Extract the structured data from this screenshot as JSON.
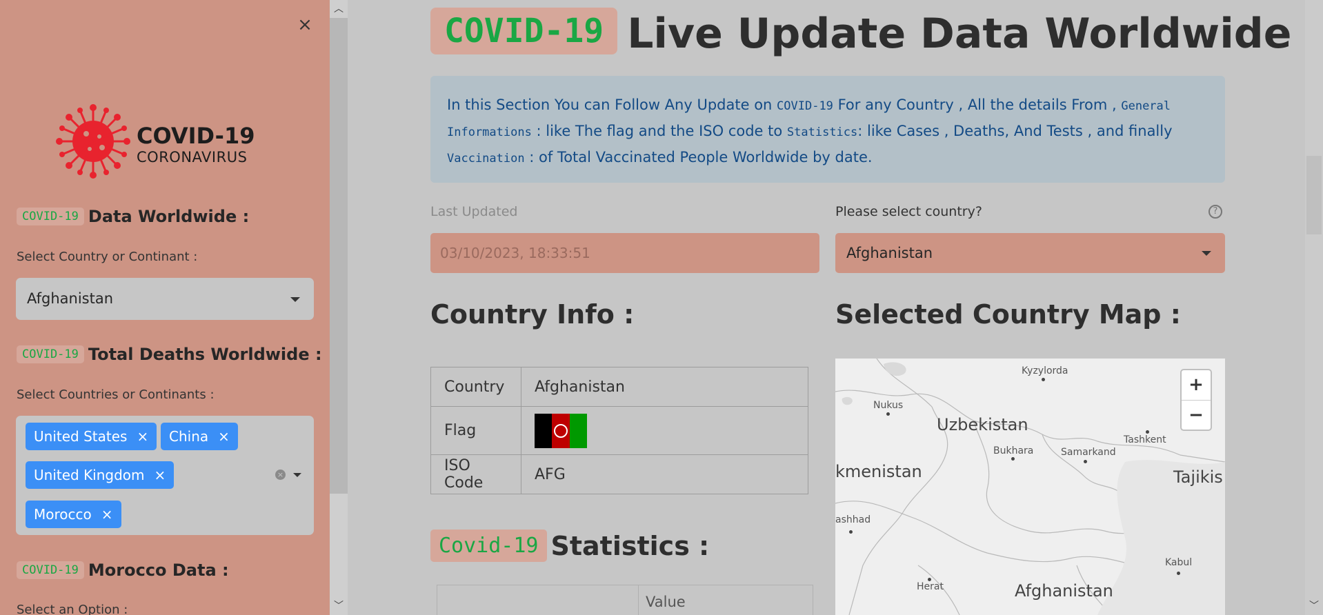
{
  "sidebar": {
    "close_label": "×",
    "logo": {
      "title": "COVID-19",
      "subtitle": "CORONAVIRUS"
    },
    "sections": [
      {
        "tag": "COVID-19",
        "title": "Data Worldwide :",
        "label": "Select Country or Continant :",
        "value": "Afghanistan"
      },
      {
        "tag": "COVID-19",
        "title": "Total Deaths Worldwide :",
        "label": "Select Countries or Continants :"
      },
      {
        "tag": "COVID-19",
        "title": "Morocco Data :",
        "label": "Select an Option :"
      }
    ],
    "chips": [
      "United States",
      "China",
      "United Kingdom",
      "Morocco"
    ],
    "chip_remove": "×"
  },
  "main": {
    "title_tag": "COVID-19",
    "title": "Live Update Data Worldwide :",
    "info": {
      "t1": "In this Section You can Follow Any Update on ",
      "c1": "COVID-19",
      "t2": " For any Country , All the details From , ",
      "c2": "General Informations",
      "t3": " : like The flag and the ISO code to ",
      "c3": "Statistics",
      "t4": ": like Cases , Deaths, And Tests , and finally ",
      "c4": "Vaccination",
      "t5": " : of Total Vaccinated People Worldwide by date."
    },
    "last_updated_label": "Last Updated",
    "last_updated_value": "03/10/2023, 18:33:51",
    "country_label": "Please select country?",
    "country_value": "Afghanistan",
    "help_icon": "?",
    "country_info_title": "Country Info :",
    "map_title": "Selected Country Map :",
    "table": [
      {
        "key": "Country",
        "value": "Afghanistan"
      },
      {
        "key": "Flag",
        "value": ""
      },
      {
        "key": "ISO Code",
        "value": "AFG"
      }
    ],
    "stats_tag": "Covid-19",
    "stats_title": "Statistics :",
    "stats_header": "Value"
  },
  "map": {
    "zoom_in": "+",
    "zoom_out": "−",
    "labels": [
      "Kyzylorda",
      "Nukus",
      "Uzbekistan",
      "Tashkent",
      "Bukhara",
      "Samarkand",
      "kmenistan",
      "Tajikis",
      "ashhad",
      "Herat",
      "Kabul",
      "Afghanistan"
    ]
  },
  "colors": {
    "sidebar_bg": "#cd9484",
    "main_bg": "#c6c6c6",
    "chip_blue": "#3b8ff6",
    "tag_green": "#1aa744",
    "info_text": "#134a85",
    "flag_black": "#000000",
    "flag_red": "#be0000",
    "flag_green": "#009900",
    "virus_red": "#e8232e"
  }
}
